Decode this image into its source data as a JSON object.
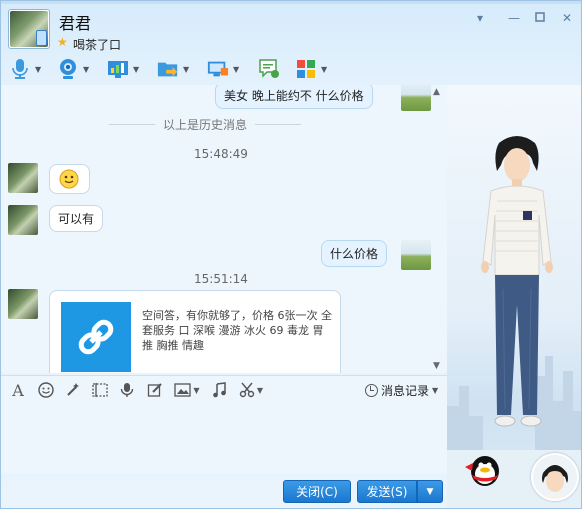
{
  "header": {
    "contact_name": "君君",
    "status_message": "喝茶了口"
  },
  "toolbar": {
    "items": [
      {
        "icon": "microphone-icon"
      },
      {
        "icon": "video-camera-icon"
      },
      {
        "icon": "screen-share-icon"
      },
      {
        "icon": "send-file-folder-icon"
      },
      {
        "icon": "remote-assist-icon"
      },
      {
        "icon": "message-bubble-icon"
      },
      {
        "icon": "apps-grid-icon"
      }
    ]
  },
  "chat": {
    "history_label": "以上是历史消息",
    "messages": [
      {
        "from": "me",
        "text": "美女 晚上能约不 什么价格"
      },
      {
        "time": "15:48:49"
      },
      {
        "from": "contact",
        "emoji": "smiley-emoji"
      },
      {
        "from": "contact",
        "text": "可以有"
      },
      {
        "from": "me",
        "text": "什么价格"
      },
      {
        "time": "15:51:14"
      },
      {
        "from": "contact",
        "card_text": "空间答，有你就够了，价格 6张一次 全套服务 口 深喉 漫游 冰火 69 毒龙 胃推 胸推 情趣",
        "card_icon": "link-icon"
      }
    ]
  },
  "input_toolbar": {
    "history_button": "消息记录"
  },
  "buttons": {
    "close": "关闭(C)",
    "send": "发送(S)"
  },
  "colors": {
    "accent": "#1e98e3",
    "button": "#1b77cf",
    "background": "#e9f4fd"
  }
}
